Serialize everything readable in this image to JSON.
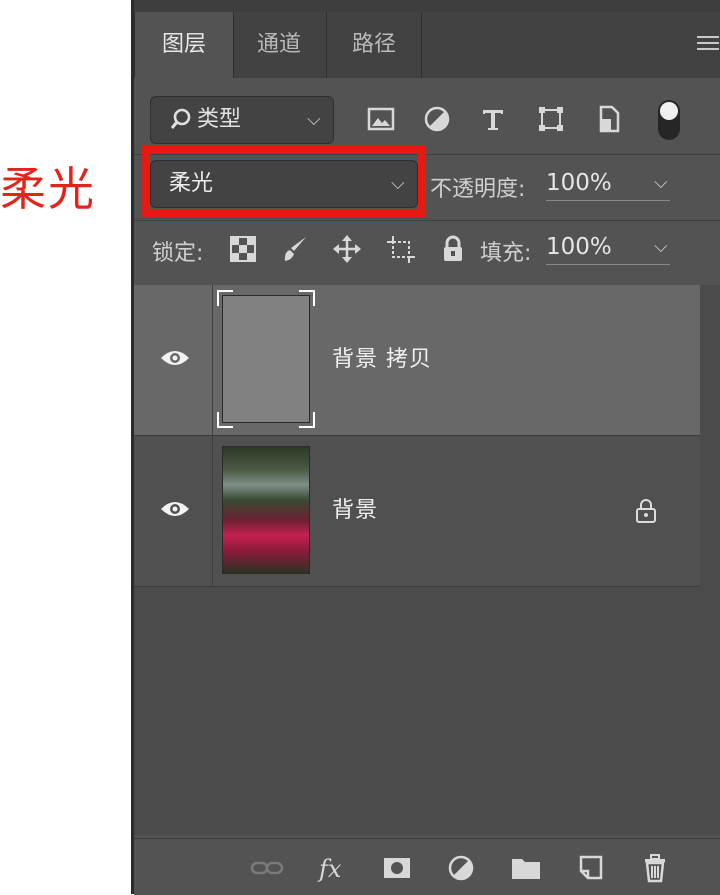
{
  "annotation": {
    "label": "柔光",
    "color": "#e4241b"
  },
  "panel": {
    "tabs": [
      {
        "label": "图层",
        "active": true
      },
      {
        "label": "通道",
        "active": false
      },
      {
        "label": "路径",
        "active": false
      }
    ],
    "menu_icon": "panel-menu-icon"
  },
  "filter": {
    "kind_label": "类型",
    "icons": [
      "pixel-filter-icon",
      "adjustment-filter-icon",
      "type-filter-icon",
      "shape-filter-icon",
      "smart-object-filter-icon",
      "filter-toggle"
    ]
  },
  "blend": {
    "mode": "柔光",
    "opacity_label": "不透明度:",
    "opacity_value": "100%"
  },
  "lock": {
    "label": "锁定:",
    "fill_label": "填充:",
    "fill_value": "100%",
    "icons": [
      "lock-transparent-icon",
      "lock-image-icon",
      "lock-position-icon",
      "lock-artboard-icon",
      "lock-all-icon"
    ]
  },
  "layers": [
    {
      "name": "背景 拷贝",
      "visible": true,
      "selected": true,
      "locked": false,
      "thumb": "gray"
    },
    {
      "name": "背景",
      "visible": true,
      "selected": false,
      "locked": true,
      "thumb": "photo"
    }
  ],
  "bottom_icons": [
    "link-icon",
    "fx-icon",
    "mask-icon",
    "adjustment-icon",
    "folder-icon",
    "new-layer-icon",
    "trash-icon"
  ],
  "colors": {
    "panel_bg": "#535353",
    "selected_row": "#686868",
    "highlight_box": "#e51a12"
  }
}
